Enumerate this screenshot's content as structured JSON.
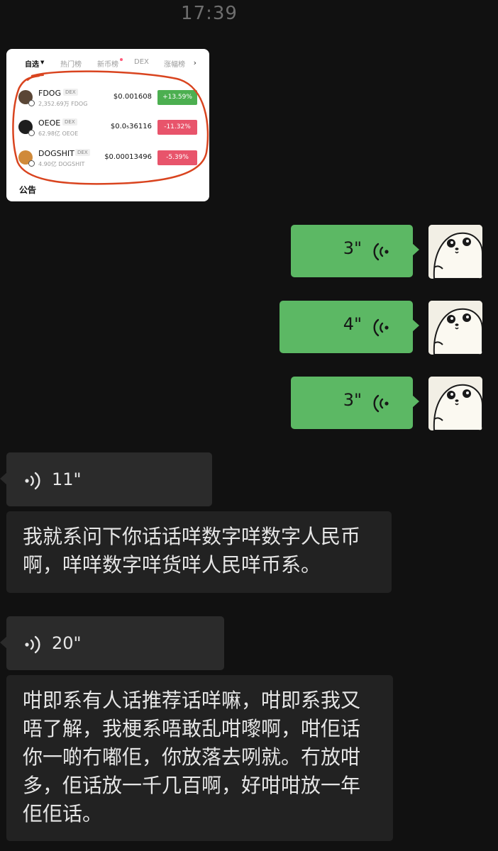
{
  "status": {
    "time": "17:39"
  },
  "market_card": {
    "tabs": [
      {
        "label": "自选",
        "active": true
      },
      {
        "label": "热门榜"
      },
      {
        "label": "新币榜"
      },
      {
        "label": "DEX"
      },
      {
        "label": "涨幅榜"
      }
    ],
    "dex_tag": "DEX",
    "rows": [
      {
        "name": "FDOG",
        "sub": "2,352.69万 FDOG",
        "price": "$0.001608",
        "change": "+13.59%",
        "direction": "up"
      },
      {
        "name": "OEOE",
        "sub": "62.98亿 OEOE",
        "price": "$0.0₅36116",
        "change": "-11.32%",
        "direction": "down"
      },
      {
        "name": "DOGSHIT",
        "sub": "4.90亿 DOGSHIT",
        "price": "$0.00013496",
        "change": "-5.39%",
        "direction": "down"
      }
    ],
    "notice_label": "公告"
  },
  "messages": {
    "outgoing": [
      {
        "duration": "3\""
      },
      {
        "duration": "4\""
      },
      {
        "duration": "3\""
      }
    ],
    "incoming": [
      {
        "duration": "11\"",
        "transcript": "我就系问下你话话咩数字咩数字人民币啊，咩咩数字咩货咩人民咩币系。"
      },
      {
        "duration": "20\"",
        "transcript": "咁即系有人话推荐话咩嘛，咁即系我又唔了解，我梗系唔敢乱咁嚟啊，咁佢话你一啲冇嘟佢，你放落去咧就。冇放咁多，佢话放一千几百啊，好咁咁放一年佢佢话。"
      }
    ]
  },
  "colors": {
    "background": "#111111",
    "outgoing_bubble": "#5cb864",
    "incoming_bubble": "#2b2b2b",
    "up": "#4caf50",
    "down": "#e8546b",
    "annotation": "#d9441f"
  }
}
